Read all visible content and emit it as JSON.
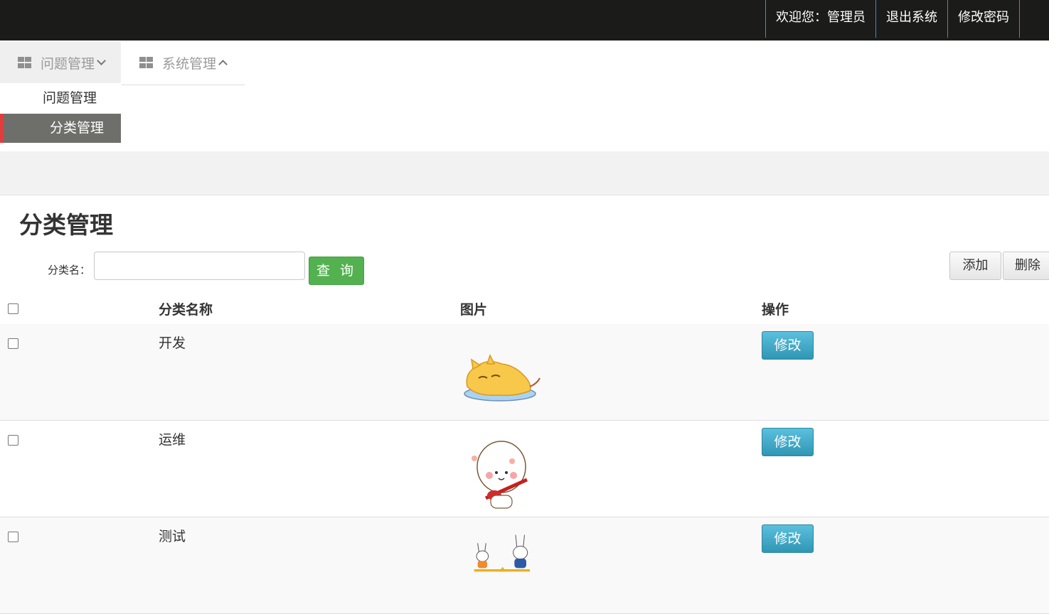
{
  "topnav": {
    "welcome": "欢迎您：管理员",
    "logout": "退出系统",
    "change_password": "修改密码"
  },
  "menu": {
    "question_mgmt": "问题管理",
    "system_mgmt": "系统管理",
    "sub_items": [
      "问题管理",
      "分类管理"
    ],
    "active_sub": "分类管理"
  },
  "page": {
    "title": "分类管理",
    "search_label": "分类名：",
    "search_value": "",
    "search_button": "查 询",
    "add_button": "添加",
    "delete_button": "删除"
  },
  "table": {
    "columns": [
      "",
      "分类名称",
      "图片",
      "操作"
    ],
    "rows": [
      {
        "name": "开发",
        "image": "yellow-cat-sticker",
        "action": "修改"
      },
      {
        "name": "运维",
        "image": "guitar-bun-sticker",
        "action": "修改"
      },
      {
        "name": "测试",
        "image": "bunny-seesaw-sticker",
        "action": "修改"
      }
    ]
  },
  "colors": {
    "topbar": "#1b1b19",
    "search_button": "#53b150",
    "edit_button": "#3aa3c4",
    "active_menu": "#6e6e6b",
    "active_marker": "#e23d3d"
  }
}
